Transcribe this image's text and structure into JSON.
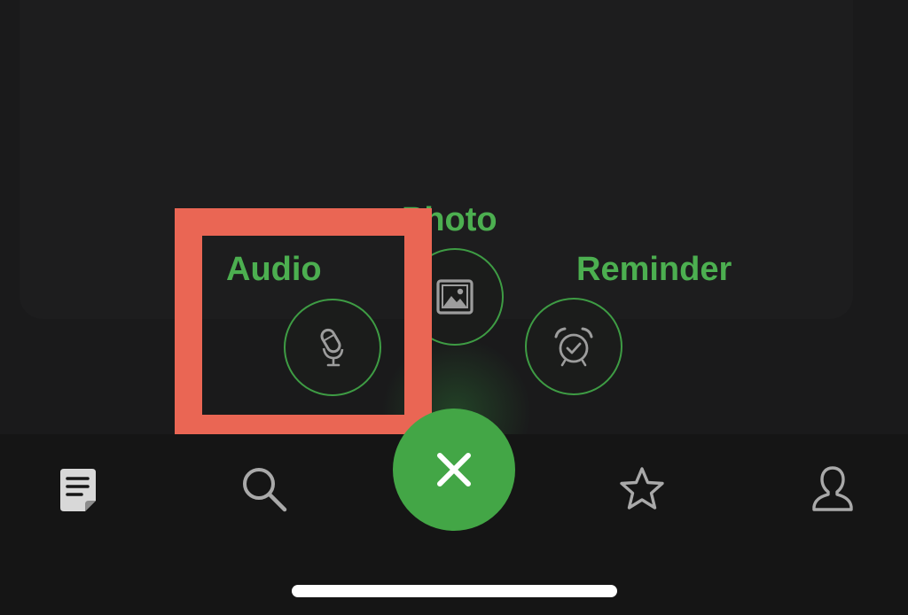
{
  "actions": {
    "audio": {
      "label": "Audio",
      "icon": "microphone-icon"
    },
    "photo": {
      "label": "Photo",
      "icon": "image-icon"
    },
    "reminder": {
      "label": "Reminder",
      "icon": "alarm-clock-icon"
    }
  },
  "tab_bar": {
    "items": [
      {
        "icon": "note-icon",
        "state": "selected"
      },
      {
        "icon": "search-icon"
      },
      {
        "icon": "close-icon",
        "role": "primary"
      },
      {
        "icon": "star-icon"
      },
      {
        "icon": "person-icon"
      }
    ]
  },
  "colors": {
    "accent_green": "#4caf50",
    "fab_green": "#43a646",
    "highlight": "#ea6654",
    "background": "#151515",
    "icon_gray": "#a9a9a9"
  }
}
